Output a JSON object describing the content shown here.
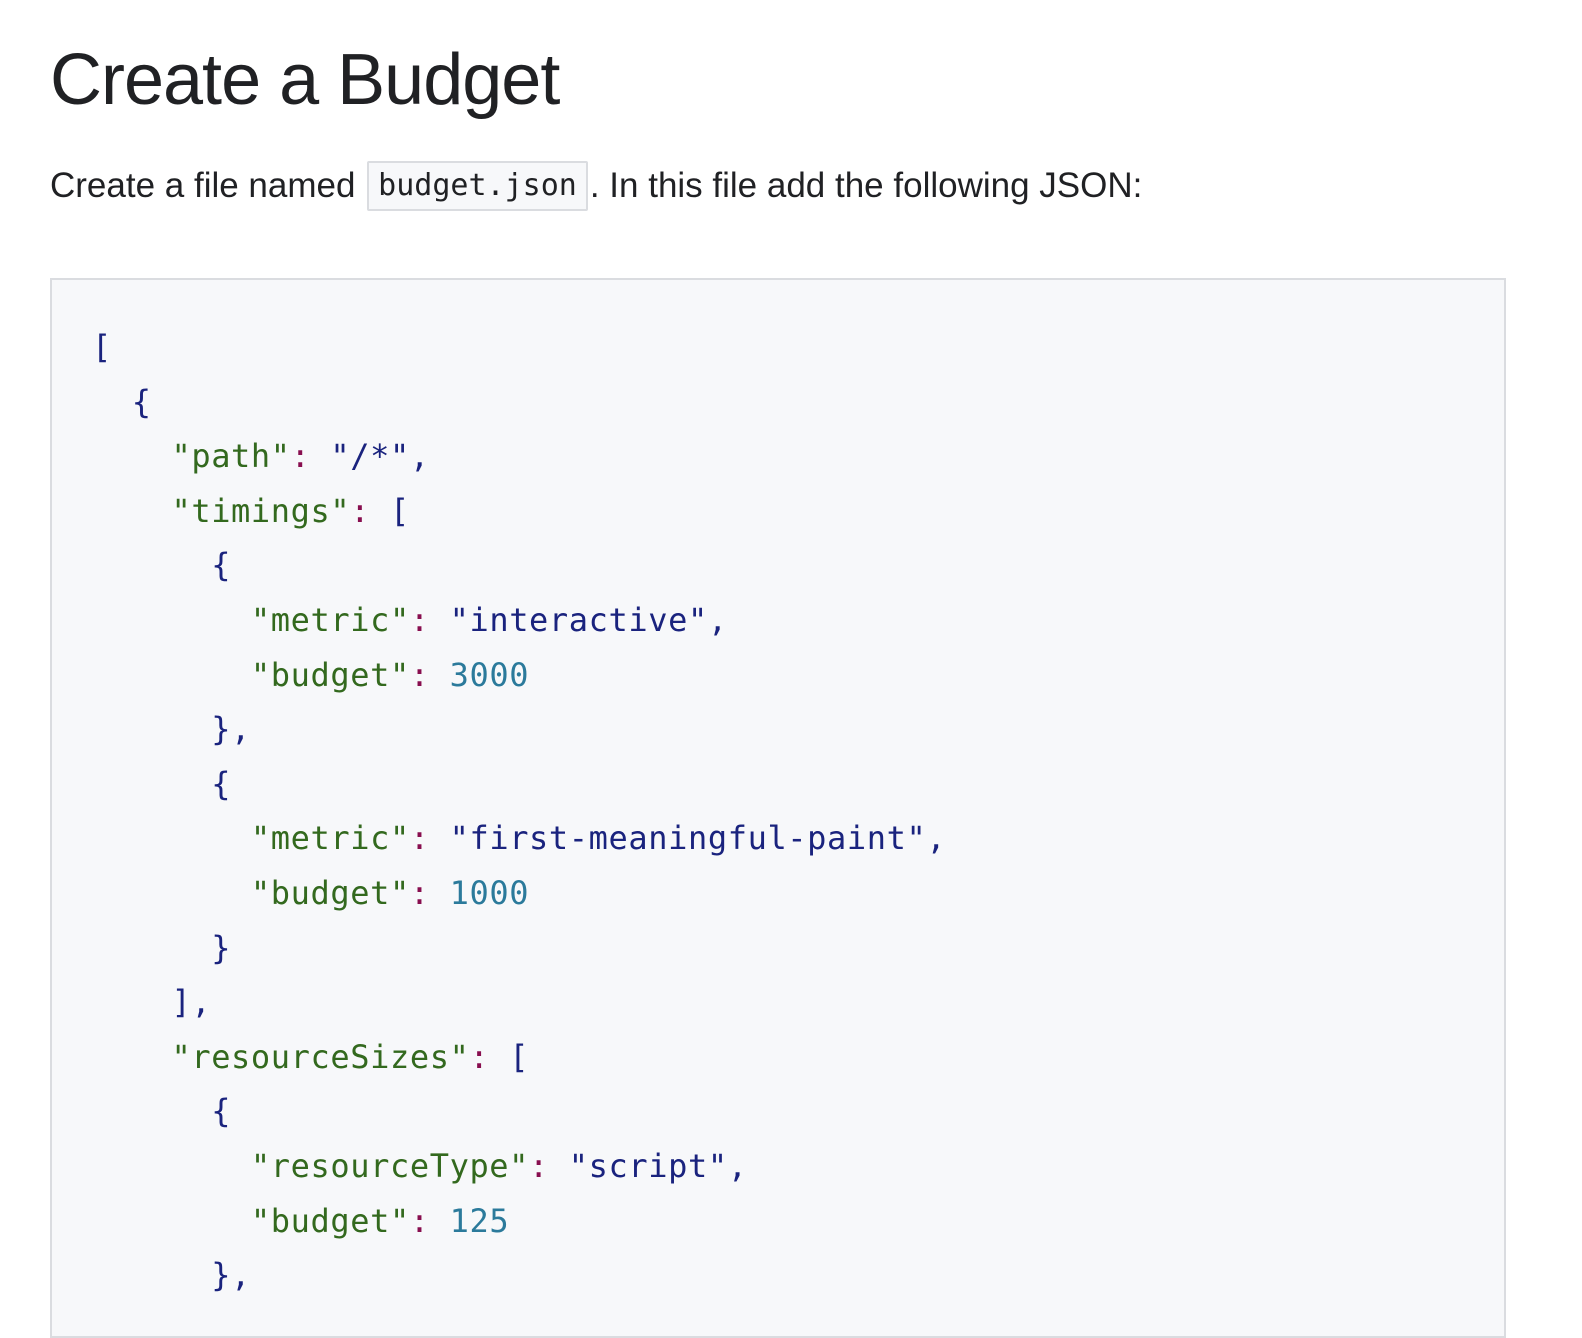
{
  "page": {
    "title": "Create a Budget",
    "intro_before": "Create a file named ",
    "intro_code": "budget.json",
    "intro_after": ". In this file add the following JSON:"
  },
  "code": {
    "language": "json",
    "lines": [
      [
        {
          "t": "punct",
          "v": "["
        }
      ],
      [
        {
          "t": "punct",
          "v": "  {"
        }
      ],
      [
        {
          "t": "key",
          "v": "    \"path\""
        },
        {
          "t": "colon",
          "v": ": "
        },
        {
          "t": "string",
          "v": "\"/*\""
        },
        {
          "t": "punct",
          "v": ","
        }
      ],
      [
        {
          "t": "key",
          "v": "    \"timings\""
        },
        {
          "t": "colon",
          "v": ": "
        },
        {
          "t": "punct",
          "v": "["
        }
      ],
      [
        {
          "t": "punct",
          "v": "      {"
        }
      ],
      [
        {
          "t": "key",
          "v": "        \"metric\""
        },
        {
          "t": "colon",
          "v": ": "
        },
        {
          "t": "string",
          "v": "\"interactive\""
        },
        {
          "t": "punct",
          "v": ","
        }
      ],
      [
        {
          "t": "key",
          "v": "        \"budget\""
        },
        {
          "t": "colon",
          "v": ": "
        },
        {
          "t": "number",
          "v": "3000"
        }
      ],
      [
        {
          "t": "punct",
          "v": "      },"
        }
      ],
      [
        {
          "t": "punct",
          "v": "      {"
        }
      ],
      [
        {
          "t": "key",
          "v": "        \"metric\""
        },
        {
          "t": "colon",
          "v": ": "
        },
        {
          "t": "string",
          "v": "\"first-meaningful-paint\""
        },
        {
          "t": "punct",
          "v": ","
        }
      ],
      [
        {
          "t": "key",
          "v": "        \"budget\""
        },
        {
          "t": "colon",
          "v": ": "
        },
        {
          "t": "number",
          "v": "1000"
        }
      ],
      [
        {
          "t": "punct",
          "v": "      }"
        }
      ],
      [
        {
          "t": "punct",
          "v": "    ],"
        }
      ],
      [
        {
          "t": "key",
          "v": "    \"resourceSizes\""
        },
        {
          "t": "colon",
          "v": ": "
        },
        {
          "t": "punct",
          "v": "["
        }
      ],
      [
        {
          "t": "punct",
          "v": "      {"
        }
      ],
      [
        {
          "t": "key",
          "v": "        \"resourceType\""
        },
        {
          "t": "colon",
          "v": ": "
        },
        {
          "t": "string",
          "v": "\"script\""
        },
        {
          "t": "punct",
          "v": ","
        }
      ],
      [
        {
          "t": "key",
          "v": "        \"budget\""
        },
        {
          "t": "colon",
          "v": ": "
        },
        {
          "t": "number",
          "v": "125"
        }
      ],
      [
        {
          "t": "punct",
          "v": "      },"
        }
      ]
    ]
  },
  "colors": {
    "text": "#202124",
    "code_background": "#f7f8fa",
    "code_border": "#dadce0",
    "punctuation": "#1a237e",
    "key": "#33691e",
    "colon": "#880e4f",
    "string": "#1a237e",
    "number": "#2b7a9b"
  }
}
